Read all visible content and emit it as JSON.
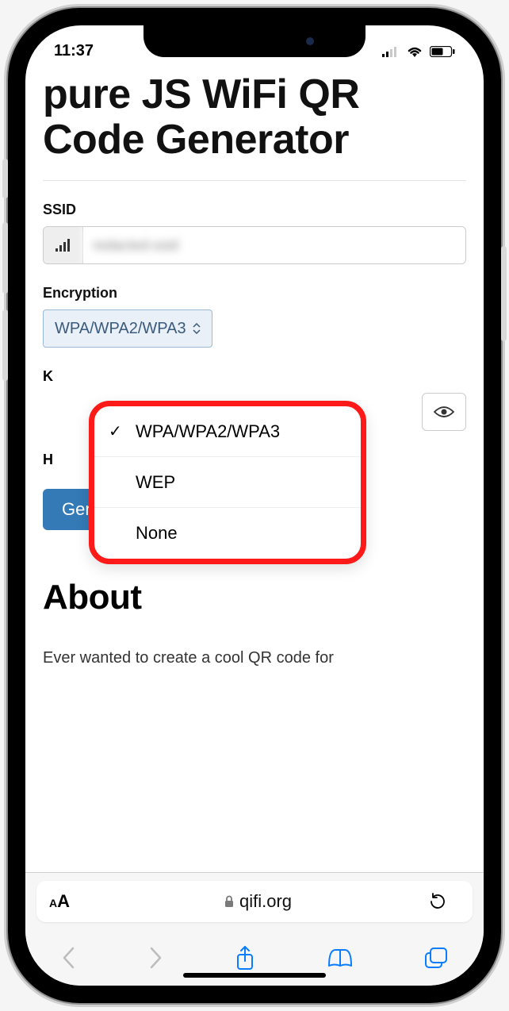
{
  "status_bar": {
    "time": "11:37"
  },
  "page": {
    "title": "pure JS WiFi QR Code Generator",
    "ssid_label": "SSID",
    "ssid_value": "redacted-ssid",
    "encryption_label": "Encryption",
    "encryption_selected": "WPA/WPA2/WPA3",
    "encryption_options": [
      {
        "label": "WPA/WPA2/WPA3",
        "selected": true
      },
      {
        "label": "WEP",
        "selected": false
      },
      {
        "label": "None",
        "selected": false
      }
    ],
    "key_label_partial": "K",
    "h_label_partial": "H",
    "generate_label": "Generate!",
    "about_heading": "About",
    "about_text": "Ever wanted to create a cool QR code for"
  },
  "safari": {
    "aa": "AA",
    "domain": "qifi.org"
  }
}
